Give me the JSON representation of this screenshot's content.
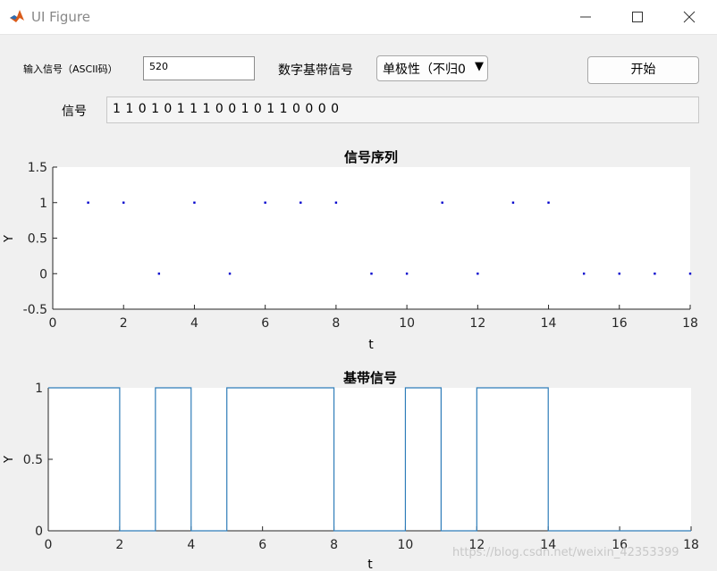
{
  "window": {
    "title": "UI Figure",
    "icon": "matlab-logo-icon",
    "controls": [
      "minimize-icon",
      "maximize-icon",
      "close-icon"
    ]
  },
  "controls": {
    "input_label": "输入信号（ASCII码）",
    "input_value": "520",
    "baseband_label": "数字基带信号",
    "baseband_selected": "单极性（不归0",
    "start_button": "开始",
    "signal_label": "信号",
    "signal_value": "1 1 0 1 0 1 1 1 0 0 1 0 1 1 0 0 0 0"
  },
  "watermark": "https://blog.csdn.net/weixin_42353399",
  "colors": {
    "stem_marker": "#0000cd",
    "line": "#2f7db9",
    "axes_bg": "#ffffff",
    "figure_bg": "#f0f0f0"
  },
  "chart_data": [
    {
      "type": "scatter",
      "title": "信号序列",
      "xlabel": "t",
      "ylabel": "Y",
      "xlim": [
        0,
        18
      ],
      "ylim": [
        -0.5,
        1.5
      ],
      "xticks": [
        "0",
        "2",
        "4",
        "6",
        "8",
        "10",
        "12",
        "14",
        "16",
        "18"
      ],
      "yticks": [
        "-0.5",
        "0",
        "0.5",
        "1",
        "1.5"
      ],
      "x": [
        1,
        2,
        3,
        4,
        5,
        6,
        7,
        8,
        9,
        10,
        11,
        12,
        13,
        14,
        15,
        16,
        17,
        18
      ],
      "y": [
        1,
        1,
        0,
        1,
        0,
        1,
        1,
        1,
        0,
        0,
        1,
        0,
        1,
        1,
        0,
        0,
        0,
        0
      ],
      "grid": false
    },
    {
      "type": "line",
      "title": "基带信号",
      "xlabel": "t",
      "ylabel": "Y",
      "xlim": [
        0,
        18
      ],
      "ylim": [
        0,
        1
      ],
      "xticks": [
        "0",
        "2",
        "4",
        "6",
        "8",
        "10",
        "12",
        "14",
        "16",
        "18"
      ],
      "yticks": [
        "0",
        "0.5",
        "1"
      ],
      "step": true,
      "levels": [
        1,
        1,
        0,
        1,
        0,
        1,
        1,
        1,
        0,
        0,
        1,
        0,
        1,
        1,
        0,
        0,
        0,
        0
      ],
      "grid": false
    }
  ]
}
